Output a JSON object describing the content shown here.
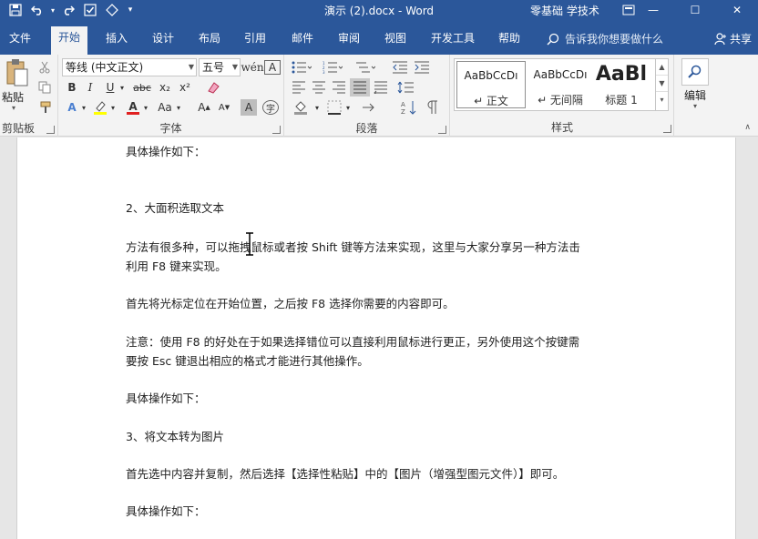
{
  "window": {
    "title": "演示 (2).docx - Word",
    "user": "零基础 学技术",
    "controls": {
      "minimize": "—",
      "maximize": "☐",
      "close": "✕"
    }
  },
  "qat": {
    "save_icon": "save-icon",
    "undo_icon": "undo-icon",
    "redo_icon": "redo-icon"
  },
  "tabs": [
    "文件",
    "开始",
    "插入",
    "设计",
    "布局",
    "引用",
    "邮件",
    "审阅",
    "视图",
    "开发工具",
    "帮助"
  ],
  "active_tab": "开始",
  "tell_me": "告诉我你想要做什么",
  "share": "共享",
  "ribbon": {
    "clipboard": {
      "paste": "粘贴",
      "group": "剪贴板"
    },
    "font": {
      "font_name": "等线 (中文正文)",
      "font_size": "五号",
      "bold": "B",
      "italic": "I",
      "underline": "U",
      "strike": "abc",
      "subscript": "x₂",
      "superscript": "x²",
      "case": "Aa",
      "grow": "A",
      "shrink": "A",
      "char_shade": "A",
      "enclose": "字",
      "group": "字体"
    },
    "paragraph": {
      "group": "段落"
    },
    "styles": {
      "items": [
        {
          "sample": "AaBbCcDı",
          "name": "↵ 正文"
        },
        {
          "sample": "AaBbCcDı",
          "name": "↵ 无间隔"
        },
        {
          "sample": "AaBl",
          "name": "标题 1"
        }
      ],
      "group": "样式"
    },
    "editing": {
      "label": "编辑"
    }
  },
  "document": {
    "paragraphs": [
      "具体操作如下：",
      "2、大面积选取文本",
      "方法有很多种，可以拖拽鼠标或者按 Shift 键等方法来实现，这里与大家分享另一种方法击",
      "利用 F8 键来实现。",
      "首先将光标定位在开始位置，之后按 F8 选择你需要的内容即可。",
      "注意：使用 F8 的好处在于如果选择错位可以直接利用鼠标进行更正，另外使用这个按键需",
      "要按 Esc 键退出相应的格式才能进行其他操作。",
      "具体操作如下：",
      "3、将文本转为图片",
      "首先选中内容并复制，然后选择【选择性粘贴】中的【图片（增强型图元文件）】即可。",
      "具体操作如下："
    ]
  }
}
